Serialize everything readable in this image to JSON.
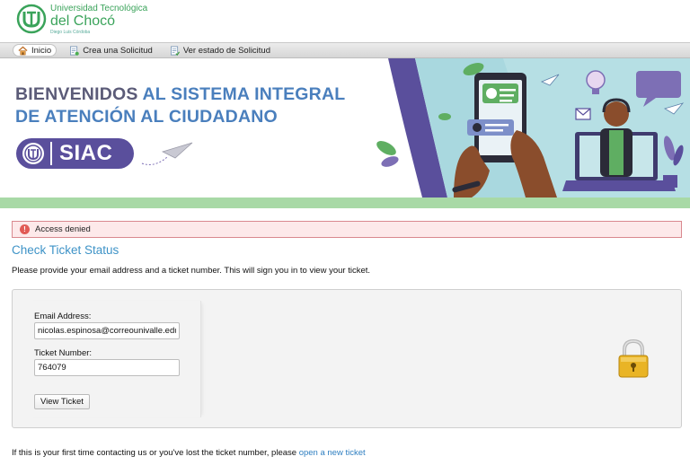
{
  "header": {
    "logo_line1": "Universidad Tecnológica",
    "logo_line2": "del Chocó",
    "logo_line3": "Diego Luis Córdoba"
  },
  "nav": {
    "items": [
      {
        "label": "Inicio",
        "icon": "home-icon",
        "active": true
      },
      {
        "label": "Crea una Solicitud",
        "icon": "new-ticket-icon"
      },
      {
        "label": "Ver estado de Solicitud",
        "icon": "ticket-status-icon"
      }
    ]
  },
  "banner": {
    "title_part1": "BIENVENIDOS ",
    "title_part2": "AL SISTEMA INTEGRAL",
    "title_line2": "DE ATENCIÓN AL CIUDADANO",
    "badge_text": "SIAC",
    "colors": {
      "purple": "#5a4f9c",
      "blue": "#4a7fbd",
      "green": "#a8d9a6"
    }
  },
  "alert": {
    "text": "Access denied",
    "color": "#e15a55"
  },
  "page_title": "Check Ticket Status",
  "intro": "Please provide your email address and a ticket number. This will sign you in to view your ticket.",
  "form": {
    "email_label": "Email Address:",
    "email_value": "nicolas.espinosa@correounivalle.edu",
    "ticket_label": "Ticket Number:",
    "ticket_value": "764079",
    "submit_label": "View Ticket"
  },
  "footer": {
    "text": "If this is your first time contacting us or you've lost the ticket number, please ",
    "link_text": "open a new ticket"
  }
}
